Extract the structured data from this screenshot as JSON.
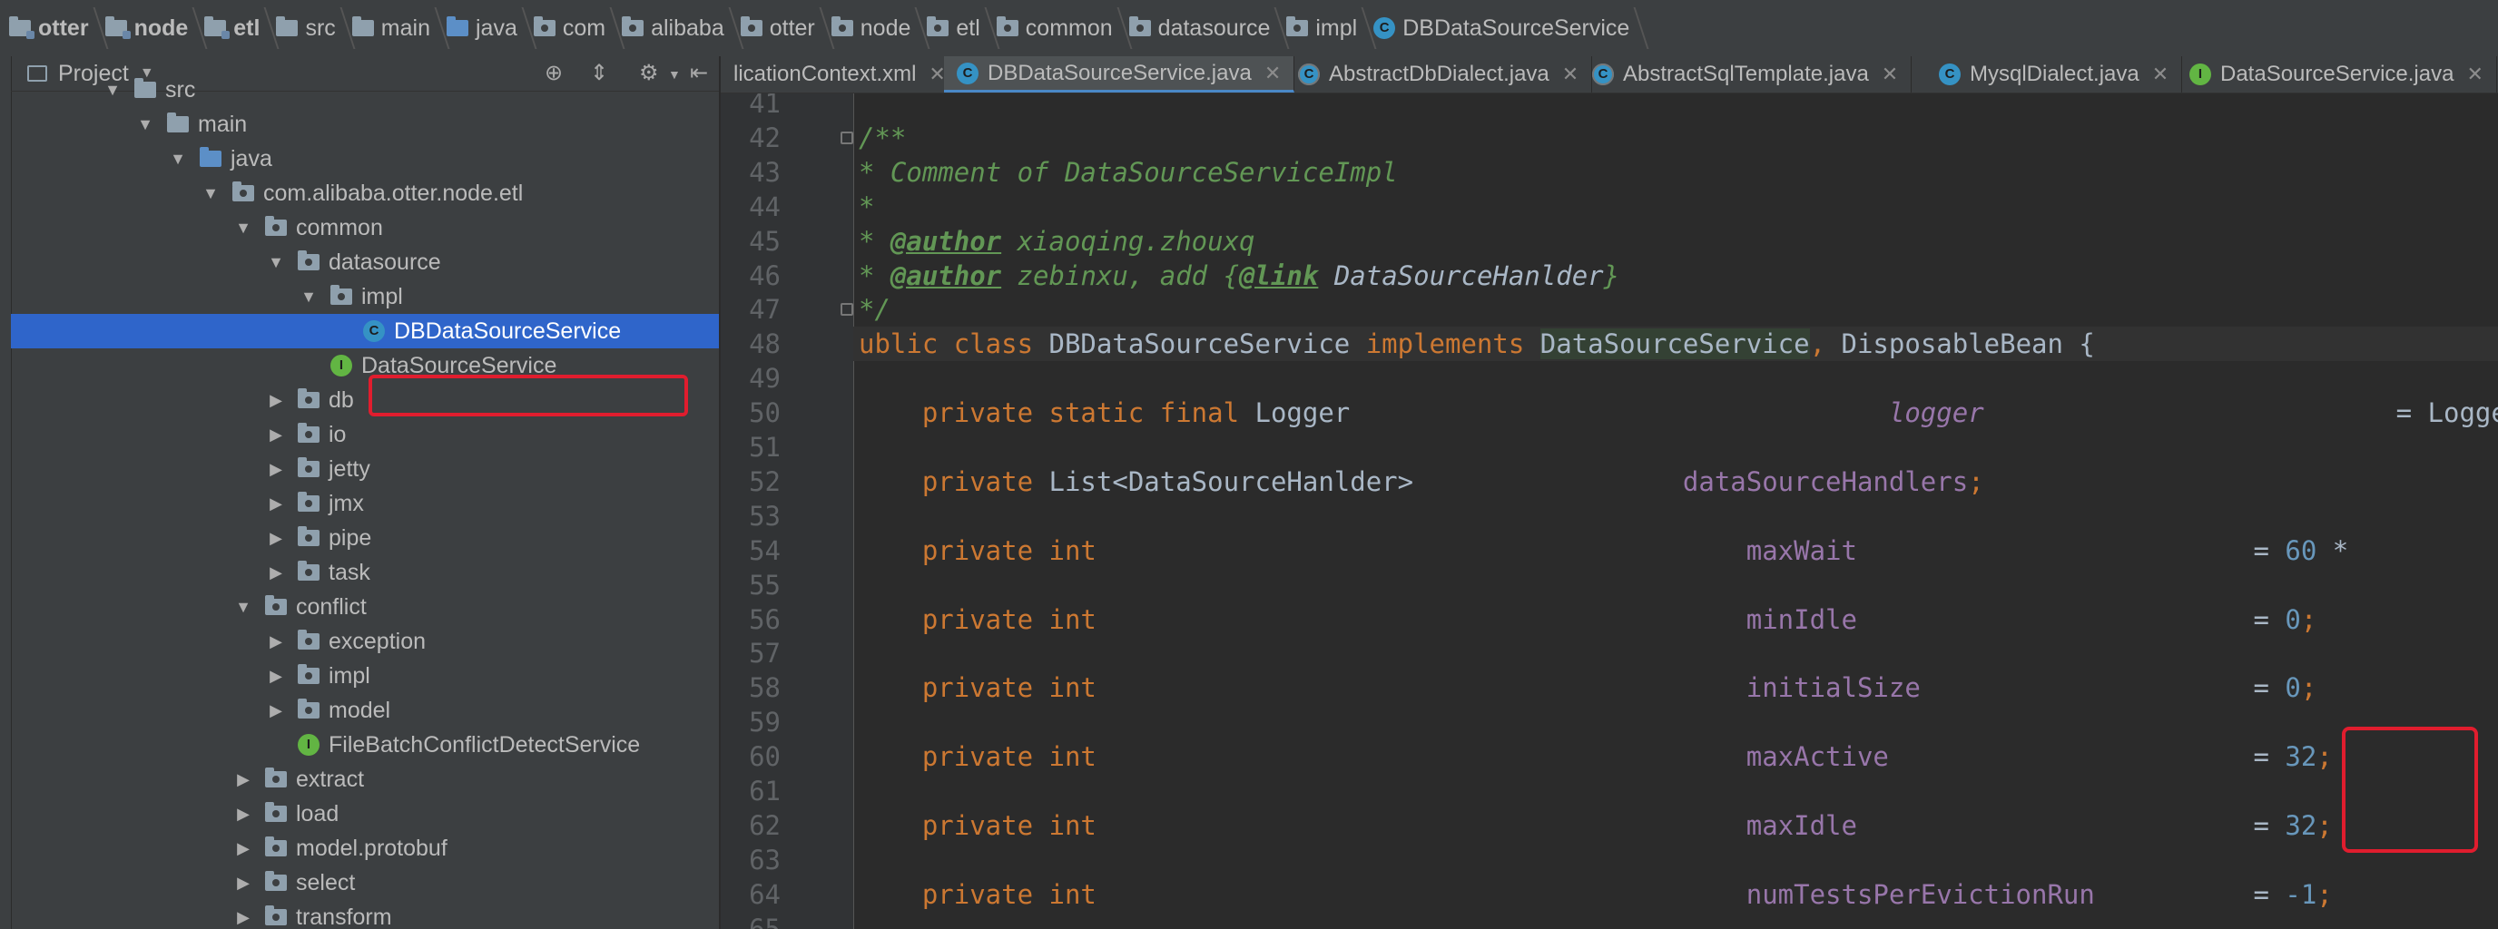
{
  "breadcrumb": [
    {
      "label": "otter",
      "icon": "module-folder-icon",
      "bold": true
    },
    {
      "label": "node",
      "icon": "module-folder-icon",
      "bold": true
    },
    {
      "label": "etl",
      "icon": "module-folder-icon",
      "bold": true
    },
    {
      "label": "src",
      "icon": "folder-icon",
      "bold": false
    },
    {
      "label": "main",
      "icon": "folder-icon",
      "bold": false
    },
    {
      "label": "java",
      "icon": "source-folder-icon",
      "bold": false
    },
    {
      "label": "com",
      "icon": "package-icon",
      "bold": false
    },
    {
      "label": "alibaba",
      "icon": "package-icon",
      "bold": false
    },
    {
      "label": "otter",
      "icon": "package-icon",
      "bold": false
    },
    {
      "label": "node",
      "icon": "package-icon",
      "bold": false
    },
    {
      "label": "etl",
      "icon": "package-icon",
      "bold": false
    },
    {
      "label": "common",
      "icon": "package-icon",
      "bold": false
    },
    {
      "label": "datasource",
      "icon": "package-icon",
      "bold": false
    },
    {
      "label": "impl",
      "icon": "package-icon",
      "bold": false
    },
    {
      "label": "DBDataSourceService",
      "icon": "class-icon",
      "bold": false
    }
  ],
  "project_panel": {
    "title": "Project",
    "tree": [
      {
        "label": "src",
        "level": 0,
        "expanded": true,
        "icon": "folder-icon"
      },
      {
        "label": "main",
        "level": 1,
        "expanded": true,
        "icon": "folder-icon"
      },
      {
        "label": "java",
        "level": 2,
        "expanded": true,
        "icon": "source-folder-icon"
      },
      {
        "label": "com.alibaba.otter.node.etl",
        "level": 3,
        "expanded": true,
        "icon": "package-icon"
      },
      {
        "label": "common",
        "level": 4,
        "expanded": true,
        "icon": "package-icon"
      },
      {
        "label": "datasource",
        "level": 5,
        "expanded": true,
        "icon": "package-icon"
      },
      {
        "label": "impl",
        "level": 6,
        "expanded": true,
        "icon": "package-icon"
      },
      {
        "label": "DBDataSourceService",
        "level": 7,
        "expanded": null,
        "icon": "class-icon",
        "selected": true
      },
      {
        "label": "DataSourceService",
        "level": 6,
        "expanded": null,
        "icon": "interface-icon"
      },
      {
        "label": "db",
        "level": 5,
        "expanded": false,
        "icon": "package-icon"
      },
      {
        "label": "io",
        "level": 5,
        "expanded": false,
        "icon": "package-icon"
      },
      {
        "label": "jetty",
        "level": 5,
        "expanded": false,
        "icon": "package-icon"
      },
      {
        "label": "jmx",
        "level": 5,
        "expanded": false,
        "icon": "package-icon"
      },
      {
        "label": "pipe",
        "level": 5,
        "expanded": false,
        "icon": "package-icon"
      },
      {
        "label": "task",
        "level": 5,
        "expanded": false,
        "icon": "package-icon"
      },
      {
        "label": "conflict",
        "level": 4,
        "expanded": true,
        "icon": "package-icon"
      },
      {
        "label": "exception",
        "level": 5,
        "expanded": false,
        "icon": "package-icon"
      },
      {
        "label": "impl",
        "level": 5,
        "expanded": false,
        "icon": "package-icon"
      },
      {
        "label": "model",
        "level": 5,
        "expanded": false,
        "icon": "package-icon"
      },
      {
        "label": "FileBatchConflictDetectService",
        "level": 5,
        "expanded": null,
        "icon": "interface-icon"
      },
      {
        "label": "extract",
        "level": 4,
        "expanded": false,
        "icon": "package-icon"
      },
      {
        "label": "load",
        "level": 4,
        "expanded": false,
        "icon": "package-icon"
      },
      {
        "label": "model.protobuf",
        "level": 4,
        "expanded": false,
        "icon": "package-icon"
      },
      {
        "label": "select",
        "level": 4,
        "expanded": false,
        "icon": "package-icon"
      },
      {
        "label": "transform",
        "level": 4,
        "expanded": false,
        "icon": "package-icon"
      }
    ]
  },
  "tabs": [
    {
      "label": "licationContext.xml",
      "icon": "xml-icon",
      "active": false
    },
    {
      "label": "DBDataSourceService.java",
      "icon": "class-icon",
      "active": true
    },
    {
      "label": "AbstractDbDialect.java",
      "icon": "abstract-class-icon",
      "active": false
    },
    {
      "label": "AbstractSqlTemplate.java",
      "icon": "abstract-class-icon",
      "active": false
    },
    {
      "label": "MysqlDialect.java",
      "icon": "class-icon",
      "active": false
    },
    {
      "label": "DataSourceService.java",
      "icon": "interface-icon",
      "active": false
    }
  ],
  "editor": {
    "line_numbers": [
      "41",
      "42",
      "43",
      "44",
      "45",
      "46",
      "47",
      "48",
      "49",
      "50",
      "51",
      "52",
      "53",
      "54",
      "55",
      "56",
      "57",
      "58",
      "59",
      "60",
      "61",
      "62",
      "63",
      "64",
      "65"
    ],
    "lines": [
      [],
      [
        {
          "t": "/**",
          "c": "doc"
        }
      ],
      [
        {
          "t": "* Comment of DataSourceServiceImpl",
          "c": "doc"
        }
      ],
      [
        {
          "t": "*",
          "c": "doc"
        }
      ],
      [
        {
          "t": "* ",
          "c": "doc"
        },
        {
          "t": "@author",
          "c": "doctag"
        },
        {
          "t": " xiaoqing.zhouxq",
          "c": "doc"
        }
      ],
      [
        {
          "t": "* ",
          "c": "doc"
        },
        {
          "t": "@author",
          "c": "doctag"
        },
        {
          "t": " zebinxu, add {",
          "c": "doc"
        },
        {
          "t": "@link",
          "c": "doctag"
        },
        {
          "t": " DataSourceHanlder",
          "c": "docref"
        },
        {
          "t": "}",
          "c": "doc"
        }
      ],
      [
        {
          "t": "*/",
          "c": "doc"
        }
      ],
      [
        {
          "t": "ublic class ",
          "c": "kw"
        },
        {
          "t": "DBDataSourceService ",
          "c": "type"
        },
        {
          "t": "implements ",
          "c": "kw"
        },
        {
          "t": "DataSourceService",
          "c": "hl"
        },
        {
          "t": ", ",
          "c": "punc"
        },
        {
          "t": "DisposableBean {",
          "c": "type"
        }
      ],
      [],
      [
        {
          "t": "    private static final ",
          "c": "kw"
        },
        {
          "t": "Logger                                  ",
          "c": "type"
        },
        {
          "t": "logger",
          "c": "static"
        },
        {
          "t": "                          = Logge",
          "c": "type"
        }
      ],
      [],
      [
        {
          "t": "    private ",
          "c": "kw"
        },
        {
          "t": "List<DataSourceHanlder>                 ",
          "c": "type"
        },
        {
          "t": "dataSourceHandlers",
          "c": "field"
        },
        {
          "t": ";",
          "c": "punc"
        }
      ],
      [],
      [
        {
          "t": "    private int                             ",
          "c": "kw"
        },
        {
          "t": "            ",
          "c": "type"
        },
        {
          "t": "maxWait",
          "c": "field"
        },
        {
          "t": "                         = ",
          "c": "type"
        },
        {
          "t": "60",
          "c": "num"
        },
        {
          "t": " * ",
          "c": "type"
        }
      ],
      [],
      [
        {
          "t": "    private int                             ",
          "c": "kw"
        },
        {
          "t": "            ",
          "c": "type"
        },
        {
          "t": "minIdle",
          "c": "field"
        },
        {
          "t": "                         = ",
          "c": "type"
        },
        {
          "t": "0",
          "c": "num"
        },
        {
          "t": ";",
          "c": "punc"
        }
      ],
      [],
      [
        {
          "t": "    private int                             ",
          "c": "kw"
        },
        {
          "t": "            ",
          "c": "type"
        },
        {
          "t": "initialSize",
          "c": "field"
        },
        {
          "t": "                     = ",
          "c": "type"
        },
        {
          "t": "0",
          "c": "num"
        },
        {
          "t": ";",
          "c": "punc"
        }
      ],
      [],
      [
        {
          "t": "    private int                             ",
          "c": "kw"
        },
        {
          "t": "            ",
          "c": "type"
        },
        {
          "t": "maxActive",
          "c": "field"
        },
        {
          "t": "                       = ",
          "c": "type"
        },
        {
          "t": "32",
          "c": "num"
        },
        {
          "t": ";",
          "c": "punc"
        }
      ],
      [],
      [
        {
          "t": "    private int                             ",
          "c": "kw"
        },
        {
          "t": "            ",
          "c": "type"
        },
        {
          "t": "maxIdle",
          "c": "field"
        },
        {
          "t": "                         = ",
          "c": "type"
        },
        {
          "t": "32",
          "c": "num"
        },
        {
          "t": ";",
          "c": "punc"
        }
      ],
      [],
      [
        {
          "t": "    private int                             ",
          "c": "kw"
        },
        {
          "t": "            ",
          "c": "type"
        },
        {
          "t": "numTestsPerEvictionRun",
          "c": "field"
        },
        {
          "t": "          = ",
          "c": "type"
        },
        {
          "t": "-1",
          "c": "num"
        },
        {
          "t": ";",
          "c": "punc"
        }
      ],
      []
    ]
  }
}
